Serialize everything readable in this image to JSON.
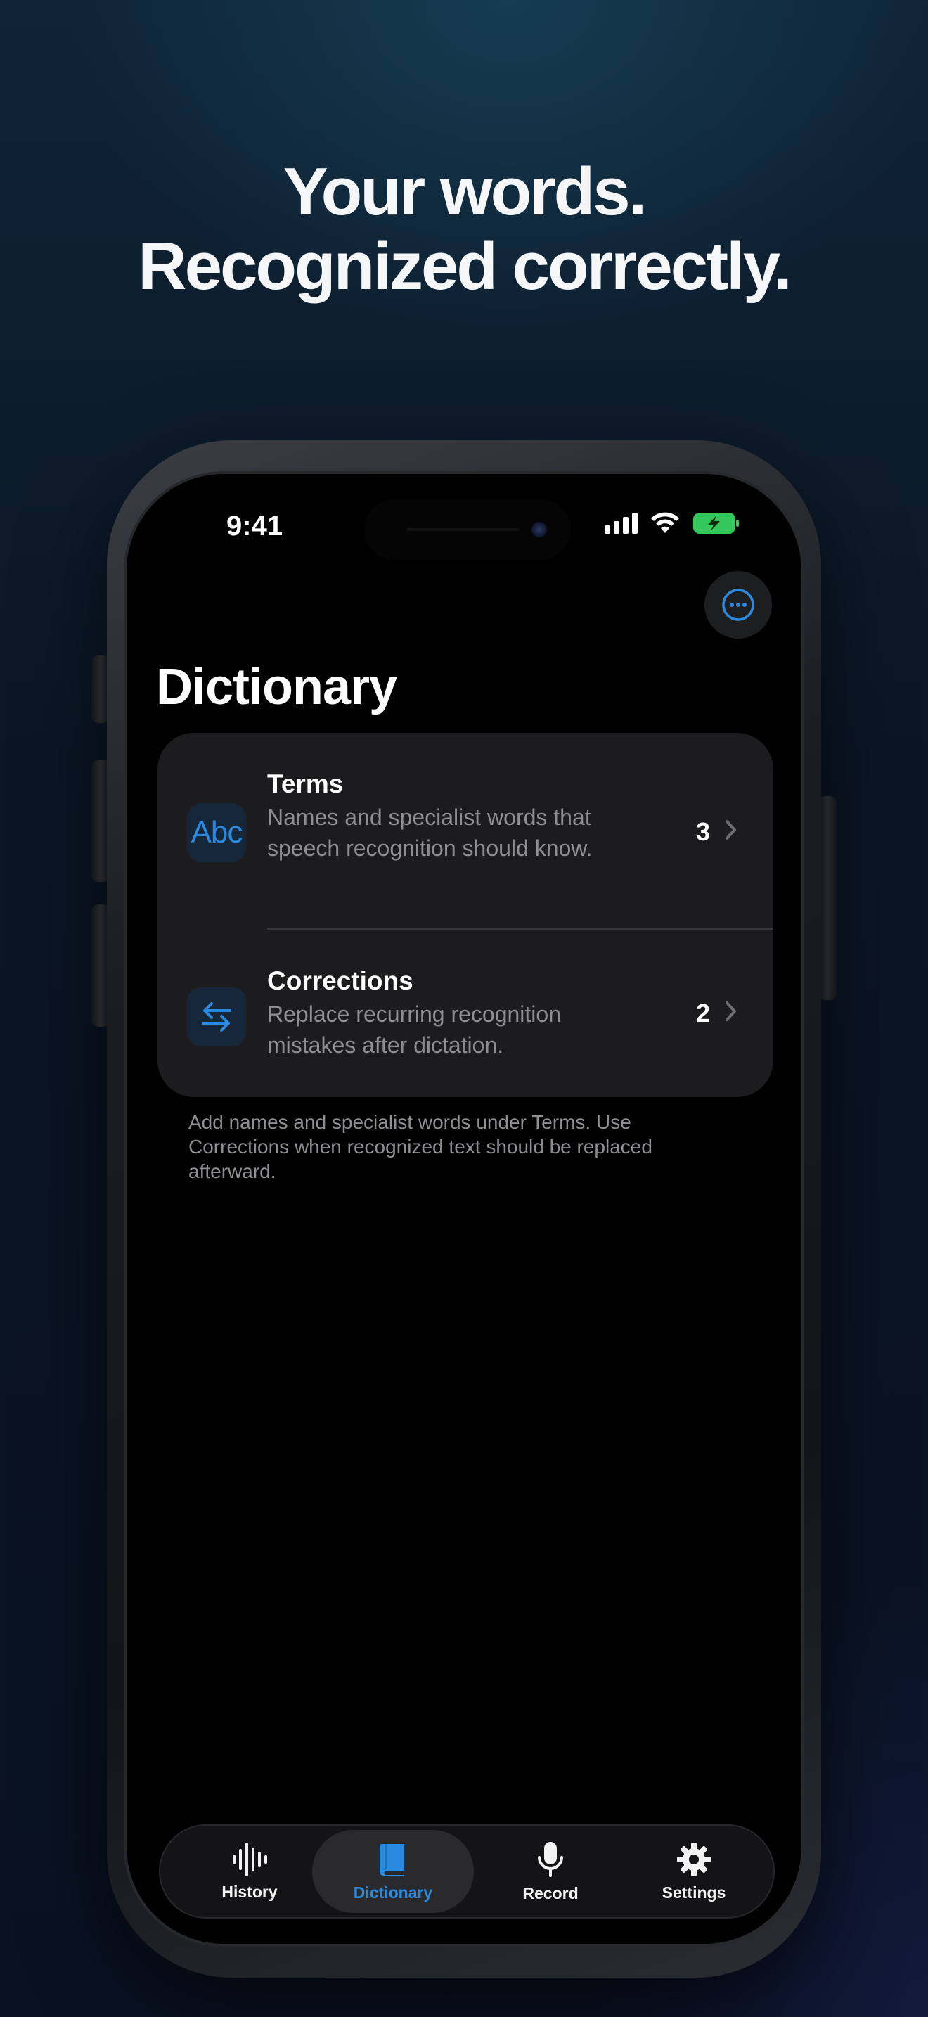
{
  "headline": {
    "line1": "Your words.",
    "line2": "Recognized correctly."
  },
  "status_bar": {
    "time": "9:41"
  },
  "screen": {
    "title": "Dictionary",
    "rows": [
      {
        "icon": "abc-text-icon",
        "icon_text": "Abc",
        "title": "Terms",
        "description": "Names and specialist words that speech recognition should know.",
        "count": "3"
      },
      {
        "icon": "swap-arrows-icon",
        "title": "Corrections",
        "description": "Replace recurring recognition mistakes after dictation.",
        "count": "2"
      }
    ],
    "footnote": "Add names and specialist words under Terms. Use Corrections when recognized text should be replaced afterward."
  },
  "tabbar": {
    "tabs": [
      {
        "label": "History",
        "icon": "waveform-icon",
        "active": false
      },
      {
        "label": "Dictionary",
        "icon": "book-icon",
        "active": true
      },
      {
        "label": "Record",
        "icon": "microphone-icon",
        "active": false
      },
      {
        "label": "Settings",
        "icon": "gear-icon",
        "active": false
      }
    ]
  },
  "colors": {
    "accent": "#2a8ae0",
    "battery": "#34c759",
    "card": "#1c1c1e",
    "secondary_text": "#8e8e93"
  }
}
